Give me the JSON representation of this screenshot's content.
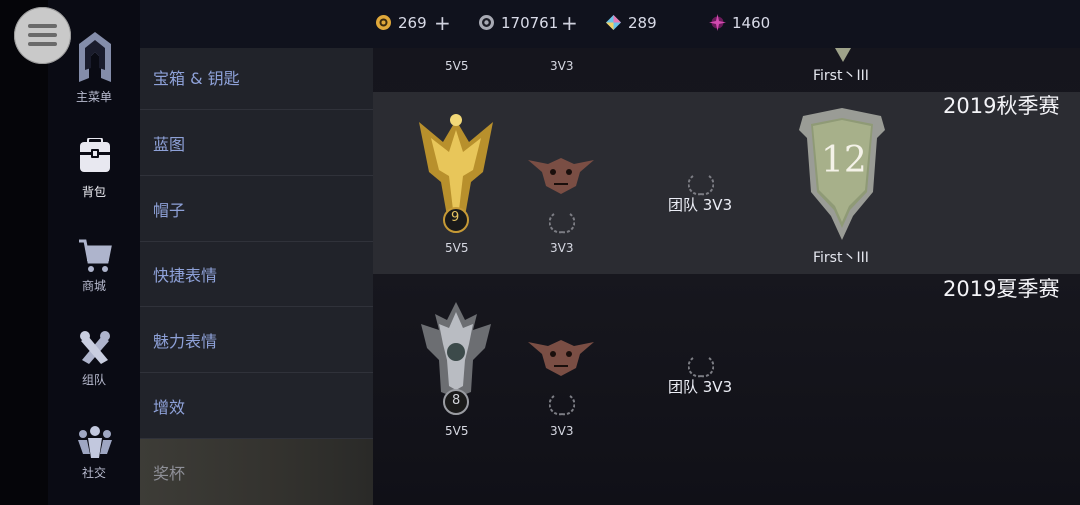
{
  "currencies": [
    {
      "icon": "gold-coin-icon",
      "value": "269",
      "color": "#e0a83a"
    },
    {
      "icon": "silver-gear-coin-icon",
      "value": "170761",
      "color": "#a8aab4"
    },
    {
      "icon": "prism-gem-icon",
      "value": "289",
      "color": "#9d7bd8"
    },
    {
      "icon": "magenta-star-icon",
      "value": "1460",
      "color": "#d24ab0"
    }
  ],
  "plus_label": "+",
  "nav": [
    {
      "label": "主菜单",
      "icon": "main-menu-emblem-icon"
    },
    {
      "label": "背包",
      "icon": "backpack-icon",
      "active": true
    },
    {
      "label": "商城",
      "icon": "shopping-cart-icon"
    },
    {
      "label": "组队",
      "icon": "crossed-arms-icon"
    },
    {
      "label": "社交",
      "icon": "social-people-icon"
    }
  ],
  "categories": [
    {
      "label": "宝箱 & 钥匙"
    },
    {
      "label": "蓝图"
    },
    {
      "label": "帽子"
    },
    {
      "label": "快捷表情"
    },
    {
      "label": "魅力表情"
    },
    {
      "label": "增效"
    },
    {
      "label": "奖杯",
      "active": true
    }
  ],
  "top_partial": {
    "mode5": "5V5",
    "mode3": "3V3",
    "rank": "First丶III"
  },
  "seasons": [
    {
      "title": "2019秋季赛",
      "trophy5_level": "9",
      "mode5": "5V5",
      "mode3": "3V3",
      "team_label": "团队 3V3",
      "medal_number": "12",
      "rank": "First丶III"
    },
    {
      "title": "2019夏季赛",
      "trophy5_level": "8",
      "mode5": "5V5",
      "mode3": "3V3",
      "team_label": "团队 3V3"
    }
  ]
}
